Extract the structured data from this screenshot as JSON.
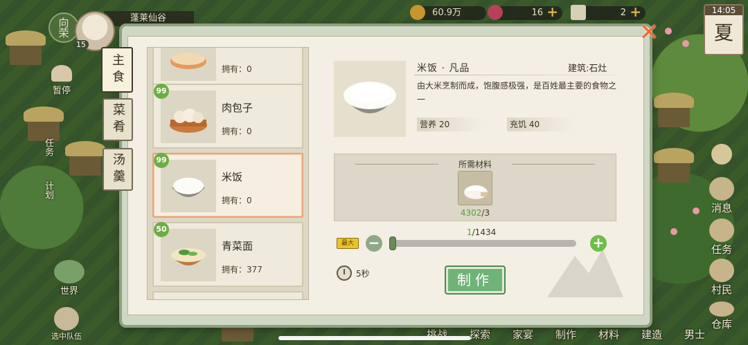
{
  "top_bar": {
    "rank_label": "向荣",
    "level": "15",
    "location": "蓬莱仙谷",
    "coins": "60.9万",
    "gems": "16",
    "tickets": "2",
    "time": "14:05",
    "season": "夏"
  },
  "left_side": {
    "pause": "暂停",
    "task": "任务",
    "plan": "计划",
    "world": "世界",
    "team": "选中队伍"
  },
  "right_side": {
    "message": "消息",
    "task": "任务",
    "villager": "村民",
    "warehouse": "仓库"
  },
  "bottom_bar": [
    "挑战",
    "探索",
    "家宴",
    "制作",
    "材料",
    "建造",
    "男士"
  ],
  "tabs": [
    "主食",
    "菜肴",
    "汤羹"
  ],
  "recipes": [
    {
      "name": "",
      "owned_label": "拥有：0",
      "badge": ""
    },
    {
      "name": "肉包子",
      "owned_label": "拥有：0",
      "badge": "99"
    },
    {
      "name": "米饭",
      "owned_label": "拥有：0",
      "badge": "99"
    },
    {
      "name": "青菜面",
      "owned_label": "拥有：377",
      "badge": "50"
    }
  ],
  "detail": {
    "title": "米饭 · 凡品",
    "building": "建筑:石灶",
    "description": "由大米烹制而成，饱腹感极强，是百姓最主要的食物之一",
    "nutrition": "营养 20",
    "satiety": "充饥 40",
    "materials_label": "所需材料",
    "material_have": "4302",
    "material_need": "/3",
    "quantity_current": "1",
    "quantity_max": "/1434",
    "max_label": "最大",
    "time": "5秒",
    "make_button": "制作",
    "quantity_fraction": 0.0007
  },
  "close_icon": "✕"
}
